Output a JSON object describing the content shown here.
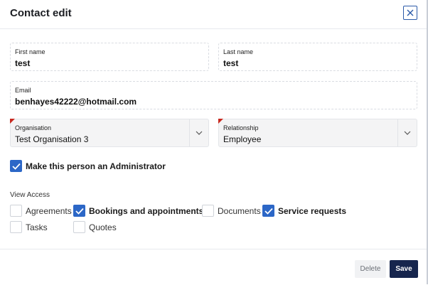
{
  "dialog": {
    "title": "Contact edit",
    "close_icon": "close-icon"
  },
  "form": {
    "first_name": {
      "label": "First name",
      "value": "test"
    },
    "last_name": {
      "label": "Last name",
      "value": "test"
    },
    "email": {
      "label": "Email",
      "value": "benhayes42222@hotmail.com"
    },
    "organisation": {
      "label": "Organisation",
      "value": "Test Organisation 3",
      "required": true
    },
    "relationship": {
      "label": "Relationship",
      "value": "Employee",
      "required": true
    },
    "admin": {
      "label": "Make this person an Administrator",
      "checked": true
    }
  },
  "view_access": {
    "label": "View Access",
    "options": [
      {
        "label": "Agreements",
        "checked": false
      },
      {
        "label": "Bookings and appointments",
        "checked": true
      },
      {
        "label": "Documents",
        "checked": false
      },
      {
        "label": "Service requests",
        "checked": true
      },
      {
        "label": "Tasks",
        "checked": false
      },
      {
        "label": "Quotes",
        "checked": false
      }
    ]
  },
  "footer": {
    "delete_label": "Delete",
    "save_label": "Save"
  },
  "colors": {
    "accent": "#2c67c7",
    "save_button": "#16254d",
    "required_marker": "#c8281e"
  }
}
